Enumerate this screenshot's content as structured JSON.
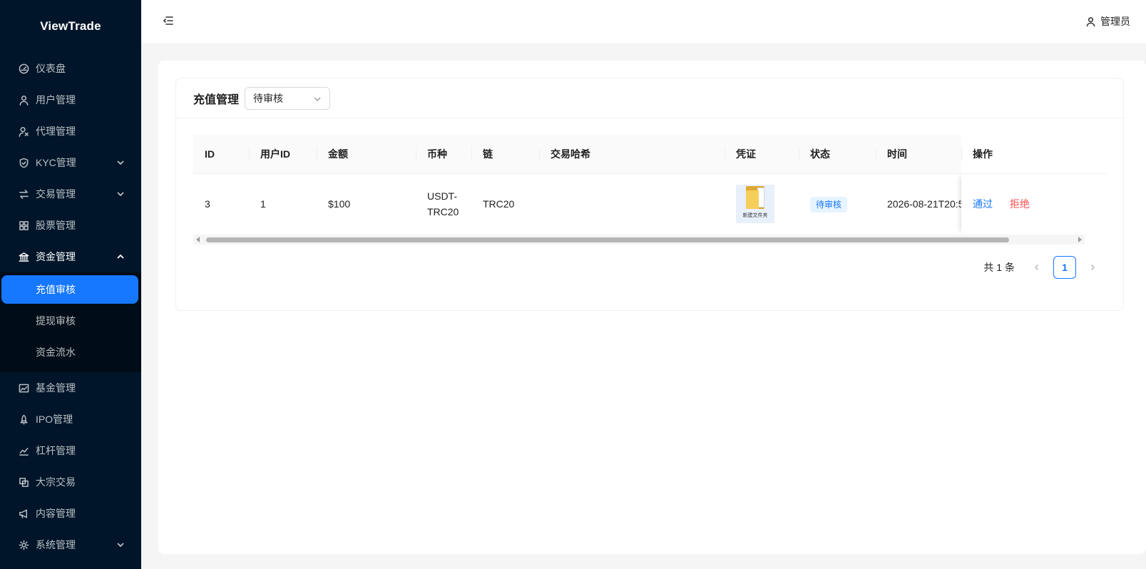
{
  "app": {
    "name": "ViewTrade"
  },
  "sidebar": {
    "items": [
      {
        "label": "仪表盘",
        "icon": "dashboard-icon"
      },
      {
        "label": "用户管理",
        "icon": "user-icon"
      },
      {
        "label": "代理管理",
        "icon": "agent-icon"
      },
      {
        "label": "KYC管理",
        "icon": "shield-icon",
        "expandable": true
      },
      {
        "label": "交易管理",
        "icon": "swap-icon",
        "expandable": true
      },
      {
        "label": "股票管理",
        "icon": "grid-icon"
      },
      {
        "label": "资金管理",
        "icon": "bank-icon",
        "expandable": true,
        "open": true
      },
      {
        "label": "基金管理",
        "icon": "fund-chart-icon"
      },
      {
        "label": "IPO管理",
        "icon": "rocket-icon"
      },
      {
        "label": "杠杆管理",
        "icon": "line-chart-icon"
      },
      {
        "label": "大宗交易",
        "icon": "block-icon"
      },
      {
        "label": "内容管理",
        "icon": "megaphone-icon"
      },
      {
        "label": "系统管理",
        "icon": "settings-icon",
        "expandable": true
      }
    ],
    "submenu": [
      {
        "label": "充值审核",
        "active": true
      },
      {
        "label": "提现审核"
      },
      {
        "label": "资金流水"
      }
    ]
  },
  "header": {
    "user_label": "管理员"
  },
  "page": {
    "title": "充值管理",
    "filter": {
      "selected": "待审核"
    }
  },
  "table": {
    "columns": [
      "ID",
      "用户ID",
      "金额",
      "币种",
      "链",
      "交易哈希",
      "凭证",
      "状态",
      "时间",
      "操作"
    ],
    "rows": [
      {
        "id": "3",
        "user_id": "1",
        "amount": "$100",
        "currency_line1": "USDT-",
        "currency_line2": "TRC20",
        "chain": "TRC20",
        "tx_hash": "",
        "proof_label": "新建文件夹",
        "status": "待审核",
        "time": "2026-08-21T20:5",
        "actions": {
          "approve": "通过",
          "reject": "拒绝"
        }
      }
    ]
  },
  "pagination": {
    "total_text": "共 1 条",
    "current": "1"
  },
  "colors": {
    "primary": "#1677ff",
    "danger": "#ff4d4f",
    "sidebar_bg": "#001529"
  }
}
